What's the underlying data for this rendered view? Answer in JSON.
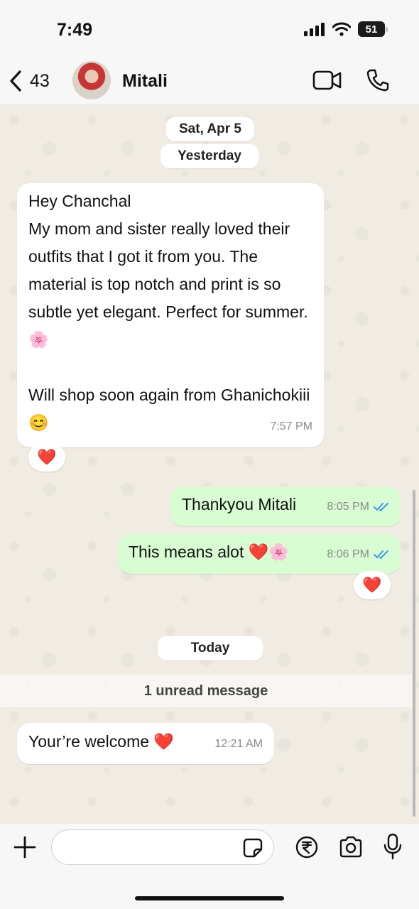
{
  "status_bar": {
    "time": "7:49",
    "battery": "51"
  },
  "header": {
    "back_count": "43",
    "contact_name": "Mitali"
  },
  "date_separators": {
    "first": "Sat, Apr 5",
    "second": "Yesterday",
    "third": "Today"
  },
  "messages": [
    {
      "direction": "incoming",
      "text": "Hey Chanchal\nMy mom and sister really loved their outfits that I got it from you. The material is top notch and print is so subtle yet elegant. Perfect for summer.🌸\n\nWill shop soon again from Ghanichokiii😊",
      "time": "7:57 PM",
      "reaction": "❤️"
    },
    {
      "direction": "outgoing",
      "text": "Thankyou Mitali",
      "time": "8:05 PM",
      "status": "read"
    },
    {
      "direction": "outgoing",
      "text": "This means alot ❤️🌸",
      "time": "8:06 PM",
      "status": "read",
      "reaction": "❤️"
    },
    {
      "direction": "incoming",
      "text": "Your’re welcome ❤️",
      "time": "12:21 AM"
    }
  ],
  "unread_banner": "1 unread message",
  "composer": {
    "value": ""
  },
  "colors": {
    "incoming_bubble": "#ffffff",
    "outgoing_bubble": "#d9fdd3",
    "read_tick": "#3a9bf0",
    "chat_bg": "#f0ece3"
  }
}
